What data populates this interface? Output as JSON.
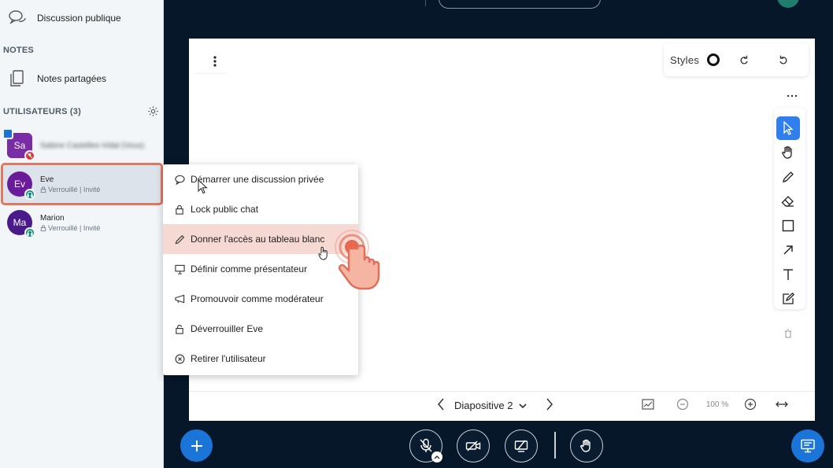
{
  "sidebar": {
    "public_chat": "Discussion publique",
    "notes_heading": "NOTES",
    "shared_notes": "Notes partagées",
    "users_heading": "UTILISATEURS (3)",
    "users": [
      {
        "initials": "Sa",
        "name": "Sabine Castelles-Vidal (Vous)",
        "status": "",
        "color": "#7a2ba6"
      },
      {
        "initials": "Ev",
        "name": "Eve",
        "status": "Verrouillé | Invité",
        "color": "#6a1b9a"
      },
      {
        "initials": "Ma",
        "name": "Marion",
        "status": "Verrouillé | Invité",
        "color": "#4a1a8a"
      }
    ]
  },
  "context_menu": {
    "items": [
      {
        "label": "Démarrer une discussion privée",
        "icon": "chat-bubble-icon"
      },
      {
        "label": "Lock public chat",
        "icon": "lock-icon"
      },
      {
        "label": "Donner l'accès au tableau blanc",
        "icon": "pencil-icon"
      },
      {
        "label": "Définir comme présentateur",
        "icon": "presentation-icon"
      },
      {
        "label": "Promouvoir comme modérateur",
        "icon": "megaphone-icon"
      },
      {
        "label": "Déverrouiller Eve",
        "icon": "unlock-icon"
      },
      {
        "label": "Retirer l'utilisateur",
        "icon": "remove-icon"
      }
    ]
  },
  "whiteboard": {
    "styles_label": "Styles",
    "slide_label": "Diapositive 2",
    "zoom_level": "100 %"
  },
  "colors": {
    "accent": "#1b74d8",
    "highlight": "#f7d9d3",
    "annotation": "#e07861",
    "background": "#06172a"
  }
}
